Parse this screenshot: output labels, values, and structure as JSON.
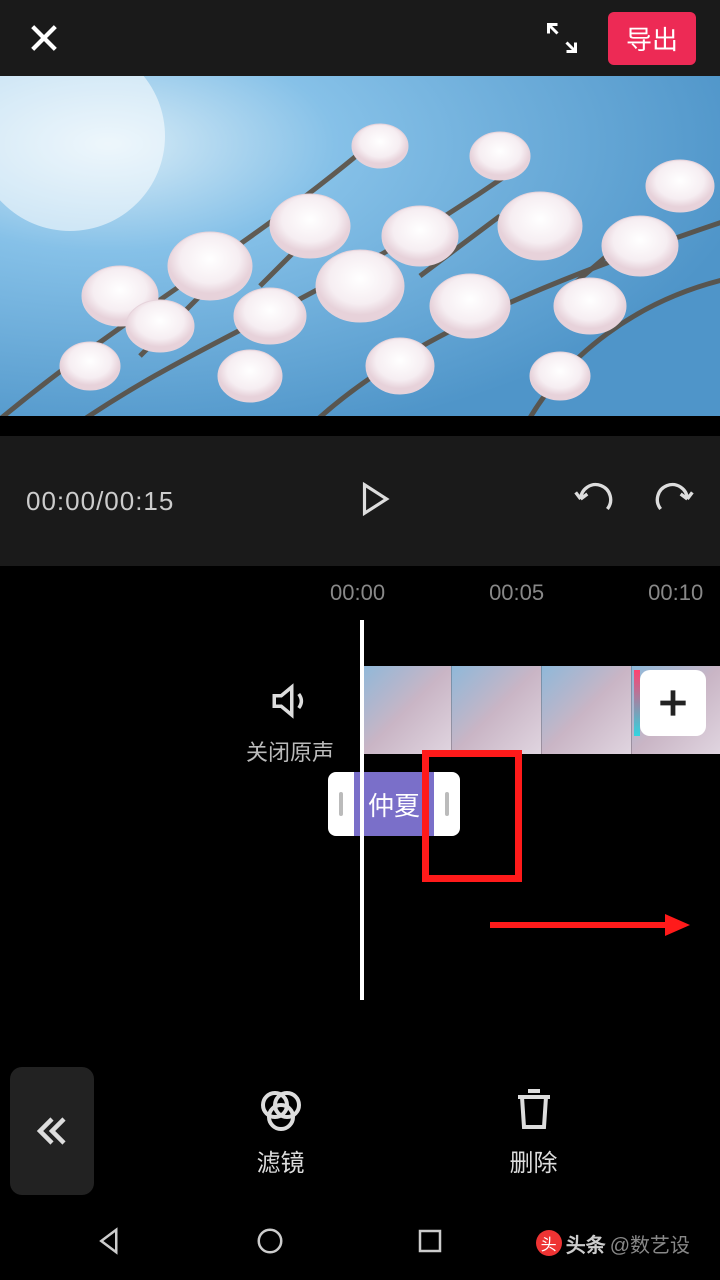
{
  "topbar": {
    "export_label": "导出"
  },
  "playback": {
    "current_time": "00:00",
    "total_time": "00:15",
    "time_display": "00:00/00:15"
  },
  "ruler": {
    "marks": [
      "00:00",
      "00:05",
      "00:10"
    ]
  },
  "sound": {
    "label": "关闭原声"
  },
  "text_clip": {
    "label": "仲夏"
  },
  "tools": {
    "filter_label": "滤镜",
    "delete_label": "删除"
  },
  "watermark": {
    "prefix": "头条",
    "handle": "@数艺设"
  },
  "colors": {
    "accent": "#ed2a55",
    "clip_purple": "#7a6fc9",
    "annotation_red": "#ff1a1a"
  }
}
